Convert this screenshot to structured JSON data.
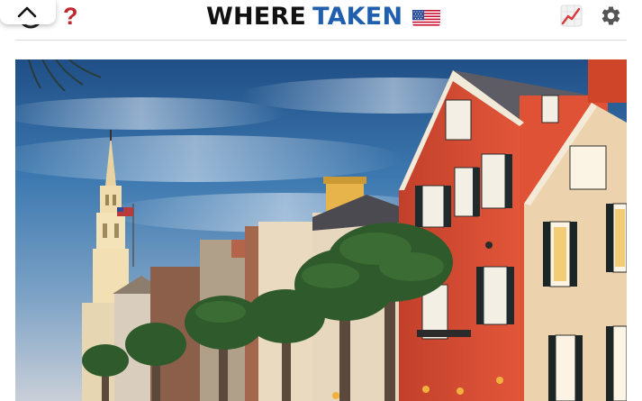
{
  "header": {
    "brand_where": "WHERE",
    "brand_taken": "TAKEN",
    "help_glyph": "?",
    "icons": [
      "chevron-up-icon",
      "profile-icon",
      "help-icon",
      "us-flag-icon",
      "stats-icon",
      "settings-icon"
    ]
  },
  "colors": {
    "brand_dark": "#111111",
    "brand_blue": "#1f5fae",
    "help_red": "#c0282d",
    "settings_gray": "#555555"
  },
  "photo": {
    "subject": "street-photo"
  }
}
